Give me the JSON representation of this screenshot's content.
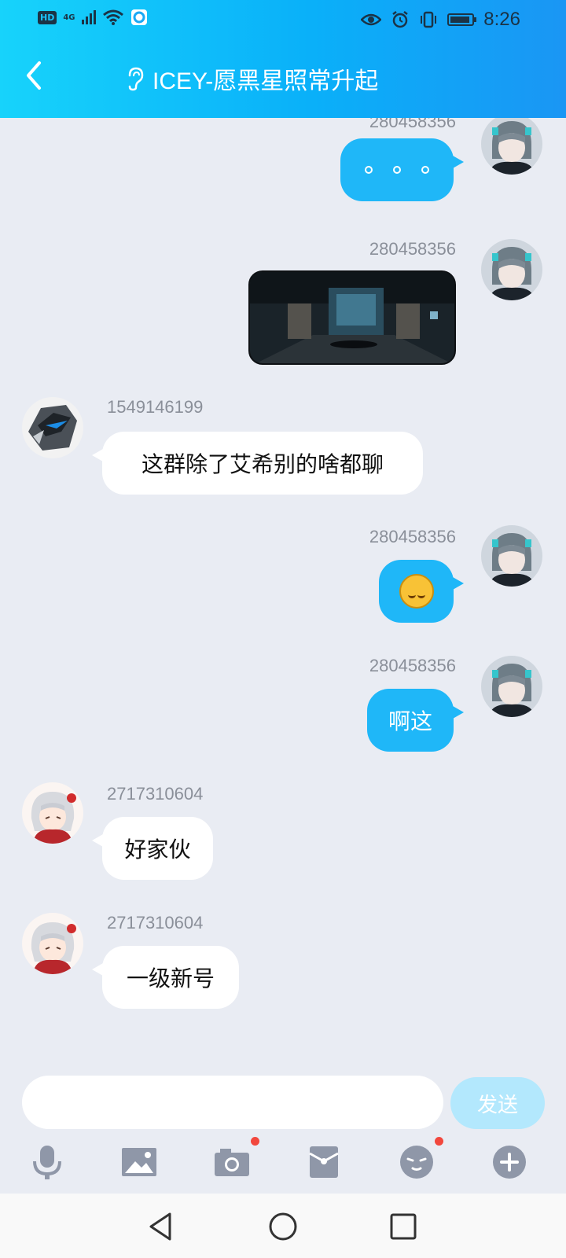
{
  "status_bar": {
    "hd_label": "HD",
    "network_label": "4G",
    "time": "8:26"
  },
  "header": {
    "title": "ICEY-愿黑星照常升起",
    "back_icon": "chevron-left-icon",
    "ear_icon": "ear-icon"
  },
  "messages": [
    {
      "sender": "280458356",
      "side": "right",
      "kind": "dots",
      "text": ""
    },
    {
      "sender": "280458356",
      "side": "right",
      "kind": "image",
      "text": ""
    },
    {
      "sender": "1549146199",
      "side": "left",
      "kind": "text",
      "text": "这群除了艾希别的啥都聊"
    },
    {
      "sender": "280458356",
      "side": "right",
      "kind": "emoji",
      "text": ""
    },
    {
      "sender": "280458356",
      "side": "right",
      "kind": "text",
      "text": "啊这"
    },
    {
      "sender": "2717310604",
      "side": "left",
      "kind": "text",
      "text": "好家伙"
    },
    {
      "sender": "2717310604",
      "side": "left",
      "kind": "text",
      "text": "一级新号"
    }
  ],
  "composer": {
    "input_value": "",
    "send_label": "发送"
  },
  "toolbar": {
    "items": [
      "mic-icon",
      "image-icon",
      "camera-icon",
      "red-packet-icon",
      "emoji-icon",
      "plus-icon"
    ]
  },
  "colors": {
    "header_start": "#17d3fb",
    "header_end": "#1a96f4",
    "my_bubble": "#1fb7f8",
    "background": "#e9ecf3",
    "send_disabled": "#b3e8fd"
  }
}
